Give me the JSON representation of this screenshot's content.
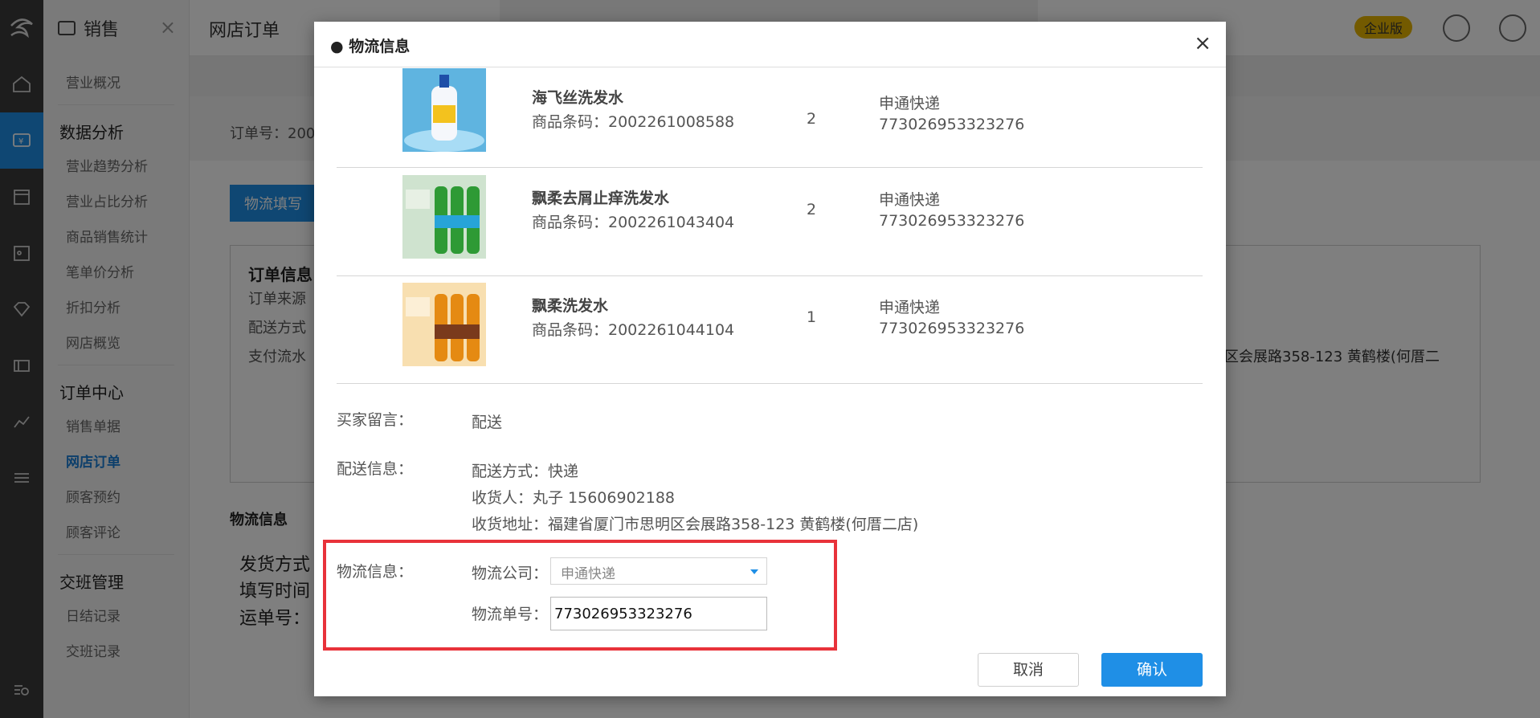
{
  "sidebar": {
    "module_title": "销售",
    "items": [
      {
        "label": "营业概况"
      },
      {
        "section": "数据分析"
      },
      {
        "label": "营业趋势分析"
      },
      {
        "label": "营业占比分析"
      },
      {
        "label": "商品销售统计"
      },
      {
        "label": "笔单价分析"
      },
      {
        "label": "折扣分析"
      },
      {
        "label": "网店概览"
      },
      {
        "section": "订单中心"
      },
      {
        "label": "销售单据"
      },
      {
        "label": "网店订单"
      },
      {
        "label": "顾客预约"
      },
      {
        "label": "顾客评论"
      },
      {
        "section": "交班管理"
      },
      {
        "label": "日结记录"
      },
      {
        "label": "交班记录"
      }
    ]
  },
  "header": {
    "page_title": "网店订单",
    "edition_badge": "企业版"
  },
  "background": {
    "order_no_label": "订单号：200",
    "logistics_fill_button": "物流填写",
    "order_info_title": "订单信息",
    "order_source": "订单来源",
    "delivery_method": "配送方式",
    "payment_flow": "支付流水",
    "address_tail": "区会展路358-123 黄鹤楼(何厝二",
    "logistics_section": "物流信息",
    "ship_method": "发货方式",
    "fill_time": "填写时间",
    "waybill_no": "运单号："
  },
  "modal": {
    "title": "● 物流信息",
    "close_label": "×",
    "products": [
      {
        "name": "海飞丝洗发水",
        "code": "商品条码：2002261008588",
        "qty": "2",
        "carrier": "申通快递",
        "tracking": "773026953323276",
        "img": "head-shoulders-bottle"
      },
      {
        "name": "飘柔去屑止痒洗发水",
        "code": "商品条码：2002261043404",
        "qty": "2",
        "carrier": "申通快递",
        "tracking": "773026953323276",
        "img": "rejoice-green-bottles"
      },
      {
        "name": "飘柔洗发水",
        "code": "商品条码：2002261044104",
        "qty": "1",
        "carrier": "申通快递",
        "tracking": "773026953323276",
        "img": "rejoice-orange-bottles"
      }
    ],
    "buyer_message_label": "买家留言：",
    "buyer_message": "配送",
    "delivery_info_label": "配送信息：",
    "delivery_method": "配送方式：快递",
    "receiver": "收货人：丸子 15606902188",
    "address": "收货地址：福建省厦门市思明区会展路358-123 黄鹤楼(何厝二店)",
    "logistics_label": "物流信息：",
    "carrier_field_label": "物流公司：",
    "carrier_selected": "申通快递",
    "tracking_field_label": "物流单号：",
    "tracking_value": "773026953323276",
    "cancel": "取消",
    "confirm": "确认"
  },
  "colors": {
    "accent": "#1f8fe6",
    "highlight": "#e8323a",
    "badge": "#e6b400"
  }
}
